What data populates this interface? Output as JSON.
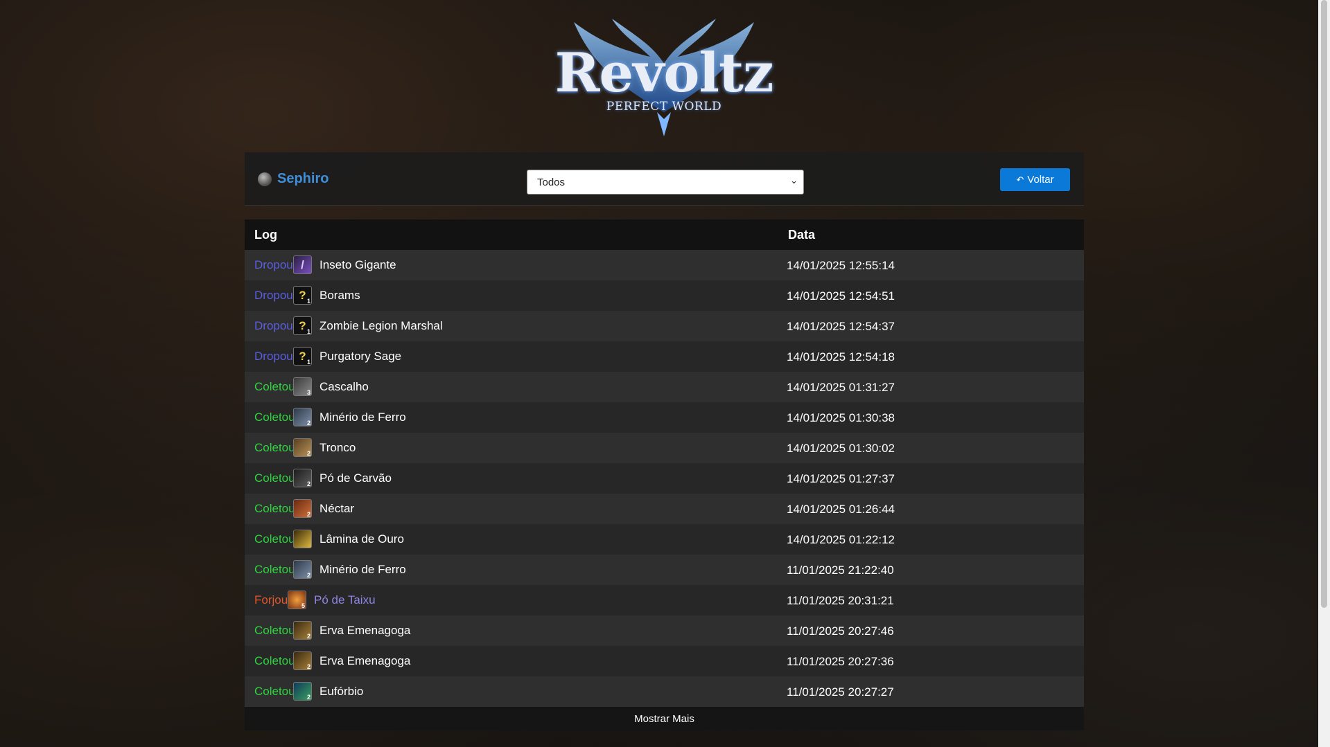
{
  "logo": {
    "title": "Revoltz",
    "subtitle": "PERFECT WORLD"
  },
  "character": {
    "name": "Sephiro"
  },
  "filter": {
    "value": "Todos"
  },
  "back_button": {
    "label": "Voltar"
  },
  "table": {
    "headers": {
      "log": "Log",
      "date": "Data"
    },
    "rows": [
      {
        "action": "Dropou",
        "action_color": "#5b5fe0",
        "item": "Inseto Gigante",
        "item_color": "#ffffff",
        "icon": "purple-feather-icon",
        "qty": "",
        "date": "14/01/2025 12:55:14"
      },
      {
        "action": "Dropou",
        "action_color": "#5b5fe0",
        "item": "Borams",
        "item_color": "#ffffff",
        "icon": "question-mark-icon",
        "qty": "1",
        "date": "14/01/2025 12:54:51"
      },
      {
        "action": "Dropou",
        "action_color": "#5b5fe0",
        "item": "Zombie Legion Marshal",
        "item_color": "#ffffff",
        "icon": "question-mark-icon",
        "qty": "1",
        "date": "14/01/2025 12:54:37"
      },
      {
        "action": "Dropou",
        "action_color": "#5b5fe0",
        "item": "Purgatory Sage",
        "item_color": "#ffffff",
        "icon": "question-mark-icon",
        "qty": "1",
        "date": "14/01/2025 12:54:18"
      },
      {
        "action": "Coletou",
        "action_color": "#2fd43f",
        "item": "Cascalho",
        "item_color": "#ffffff",
        "icon": "stone-icon",
        "qty": "3",
        "date": "14/01/2025 01:31:27"
      },
      {
        "action": "Coletou",
        "action_color": "#2fd43f",
        "item": "Minério de Ferro",
        "item_color": "#ffffff",
        "icon": "iron-ore-icon",
        "qty": "2",
        "date": "14/01/2025 01:30:38"
      },
      {
        "action": "Coletou",
        "action_color": "#2fd43f",
        "item": "Tronco",
        "item_color": "#ffffff",
        "icon": "log-icon",
        "qty": "2",
        "date": "14/01/2025 01:30:02"
      },
      {
        "action": "Coletou",
        "action_color": "#2fd43f",
        "item": "Pó de Carvão",
        "item_color": "#ffffff",
        "icon": "coal-icon",
        "qty": "2",
        "date": "14/01/2025 01:27:37"
      },
      {
        "action": "Coletou",
        "action_color": "#2fd43f",
        "item": "Néctar",
        "item_color": "#ffffff",
        "icon": "nectar-icon",
        "qty": "2",
        "date": "14/01/2025 01:26:44"
      },
      {
        "action": "Coletou",
        "action_color": "#2fd43f",
        "item": "Lâmina de Ouro",
        "item_color": "#ffffff",
        "icon": "gold-blade-icon",
        "qty": "",
        "date": "14/01/2025 01:22:12"
      },
      {
        "action": "Coletou",
        "action_color": "#2fd43f",
        "item": "Minério de Ferro",
        "item_color": "#ffffff",
        "icon": "iron-ore-icon",
        "qty": "2",
        "date": "11/01/2025 21:22:40"
      },
      {
        "action": "Forjou",
        "action_color": "#e8552a",
        "item": "Pó de Taixu",
        "item_color": "#8f86e6",
        "icon": "taixu-powder-icon",
        "qty": "5",
        "date": "11/01/2025 20:31:21"
      },
      {
        "action": "Coletou",
        "action_color": "#2fd43f",
        "item": "Erva Emenagoga",
        "item_color": "#ffffff",
        "icon": "herb-icon",
        "qty": "2",
        "date": "11/01/2025 20:27:46"
      },
      {
        "action": "Coletou",
        "action_color": "#2fd43f",
        "item": "Erva Emenagoga",
        "item_color": "#ffffff",
        "icon": "herb-icon",
        "qty": "2",
        "date": "11/01/2025 20:27:36"
      },
      {
        "action": "Coletou",
        "action_color": "#2fd43f",
        "item": "Eufórbio",
        "item_color": "#ffffff",
        "icon": "euphorbia-icon",
        "qty": "2",
        "date": "11/01/2025 20:27:27"
      }
    ]
  },
  "show_more": {
    "label": "Mostrar Mais"
  }
}
